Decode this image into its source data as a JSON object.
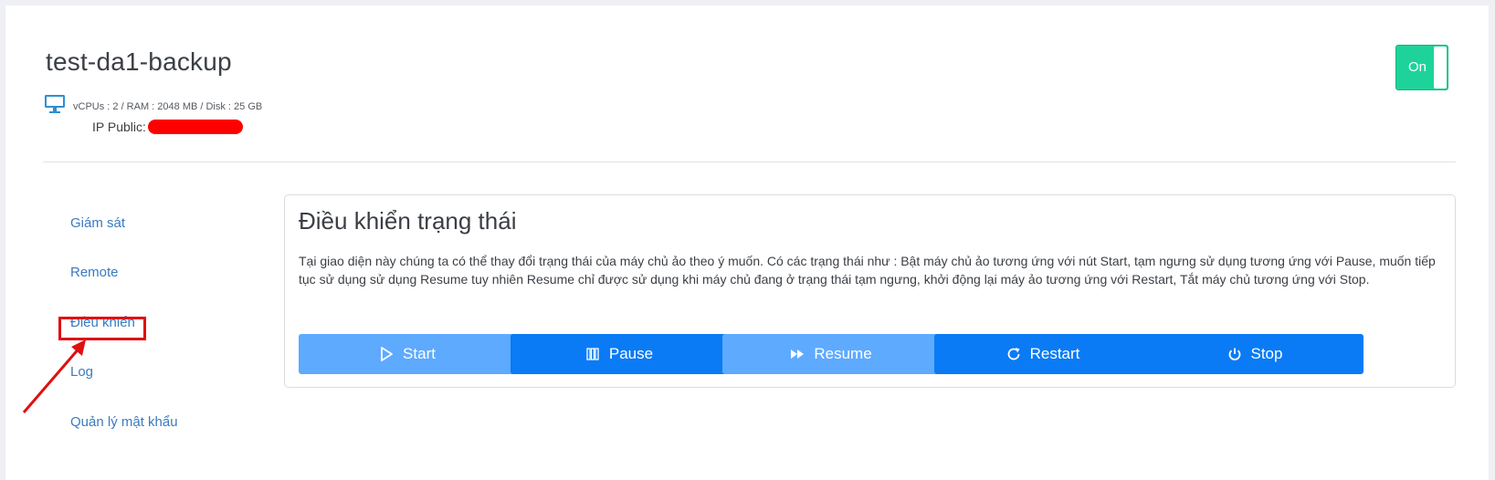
{
  "vm": {
    "name": "test-da1-backup",
    "specs": "vCPUs : 2 / RAM : 2048 MB / Disk : 25 GB",
    "ip_label": "IP Public:",
    "status_toggle": "On"
  },
  "sidebar": {
    "items": [
      {
        "label": "Giám sát"
      },
      {
        "label": "Remote"
      },
      {
        "label": "Điều khiển"
      },
      {
        "label": "Log"
      },
      {
        "label": "Quản lý mật khẩu"
      }
    ],
    "active_index": 2
  },
  "panel": {
    "title": "Điều khiển trạng thái",
    "description": "Tại giao diện này chúng ta có thể thay đổi trạng thái của máy chủ ảo theo ý muốn. Có các trạng thái như : Bật máy chủ ảo tương ứng với nút Start, tạm ngưng sử dụng tương ứng với Pause, muốn tiếp tục sử dụng sử dụng Resume tuy nhiên Resume chỉ được sử dụng khi máy chủ đang ở trạng thái tạm ngưng, khởi động lại máy ảo tương ứng với Restart, Tắt máy chủ tương ứng với Stop.",
    "buttons": [
      {
        "label": "Start",
        "icon": "play-icon",
        "enabled": false
      },
      {
        "label": "Pause",
        "icon": "pause-icon",
        "enabled": true
      },
      {
        "label": "Resume",
        "icon": "fast-forward-icon",
        "enabled": false
      },
      {
        "label": "Restart",
        "icon": "restart-icon",
        "enabled": true
      },
      {
        "label": "Stop",
        "icon": "power-icon",
        "enabled": true
      }
    ]
  },
  "colors": {
    "toggle_on": "#1ed39a",
    "button_enabled": "#0a7bf5",
    "button_disabled": "#5eaaff",
    "link": "#3a7bbf",
    "annotation": "#e01010"
  }
}
